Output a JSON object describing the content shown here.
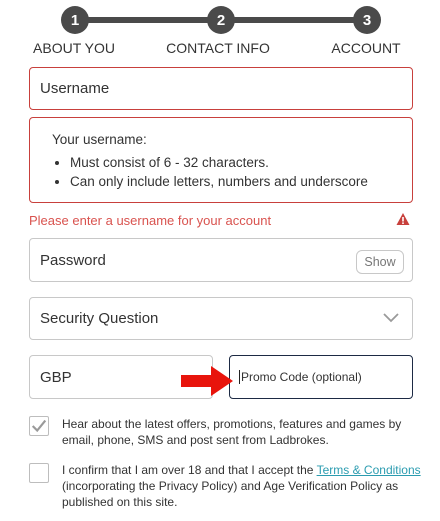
{
  "stepper": {
    "steps": [
      {
        "number": "1",
        "label": "ABOUT YOU"
      },
      {
        "number": "2",
        "label": "CONTACT INFO"
      },
      {
        "number": "3",
        "label": "ACCOUNT"
      }
    ]
  },
  "form": {
    "username": {
      "placeholder": "Username"
    },
    "username_hint": {
      "title": "Your username:",
      "rules": [
        "Must consist of 6 - 32 characters.",
        "Can only include letters, numbers and underscore"
      ]
    },
    "username_error": "Please enter a username for your account",
    "password": {
      "placeholder": "Password",
      "show_label": "Show"
    },
    "security_question": {
      "placeholder": "Security Question"
    },
    "currency": {
      "value": "GBP"
    },
    "promo": {
      "placeholder": "Promo Code (optional)"
    },
    "marketing_opt_in": {
      "checked": true,
      "text": "Hear about the latest offers, promotions, features and games by email, phone, SMS and post sent from Ladbrokes."
    },
    "terms": {
      "checked": false,
      "text_before": "I confirm that I am over 18 and that I accept the ",
      "link_label": "Terms & Conditions",
      "text_after": " (incorporating the Privacy Policy) and Age Verification Policy as published on this site."
    }
  },
  "colors": {
    "error": "#c8403c",
    "annotation_arrow": "#e8140c",
    "link": "#2b9cb0"
  },
  "icons": [
    "warning-icon",
    "chevron-down-icon",
    "checkmark-icon",
    "red-arrow-annotation"
  ]
}
